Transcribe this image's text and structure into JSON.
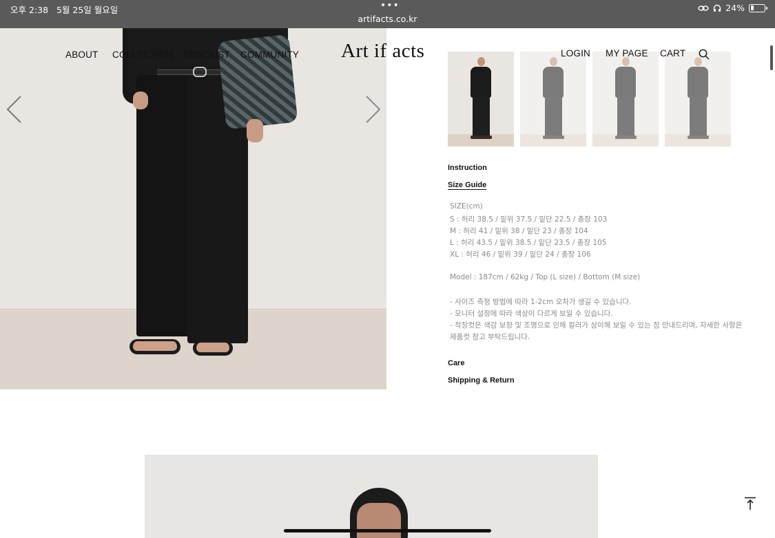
{
  "status_bar": {
    "time": "오후 2:38",
    "date": "5월 25일 월요일",
    "url": "artifacts.co.kr",
    "menu_dots": "•••",
    "battery_percent": "24%",
    "battery_level": 0.24
  },
  "nav": {
    "about": "ABOUT",
    "collection": "COLLECTION",
    "stockist": "STOCKIST",
    "community": "COMMUNITY",
    "logo": "Art if acts",
    "login": "LOGIN",
    "mypage": "MY PAGE",
    "cart": "CART",
    "search_icon": "search-icon"
  },
  "product": {
    "instruction": "Instruction",
    "size_guide": "Size Guide",
    "size_unit": "SIZE(cm)",
    "sizes": [
      "S : 허리 38.5 / 밑위 37.5 / 밑단 22.5 / 총장 103",
      "M : 허리 41 / 밑위 38 / 밑단 23 / 총장 104",
      "L : 허리 43.5 / 밑위 38.5 / 밑단 23.5 / 총장 105",
      "XL : 허리 46 / 밑위 39 / 밑단 24 / 총장 106"
    ],
    "model_info": "Model : 187cm / 62kg / Top (L size) / Bottom (M size)",
    "notes": [
      "- 사이즈 측정 방법에 따라 1-2cm 오차가 생길 수 있습니다.",
      "- 모니터 설정에 따라 색상이 다르게 보일 수 있습니다.",
      "- 착장컷은 색감 보정 및 조명으로 인해 컬러가 상이해 보일 수 있는 점 안내드리며, 자세한 사항은",
      "제품컷 참고 부탁드립니다."
    ],
    "care": "Care",
    "shipping": "Shipping & Return"
  },
  "icons": {
    "prev": "chevron-left-icon",
    "next": "chevron-right-icon",
    "top": "arrow-up-icon"
  }
}
